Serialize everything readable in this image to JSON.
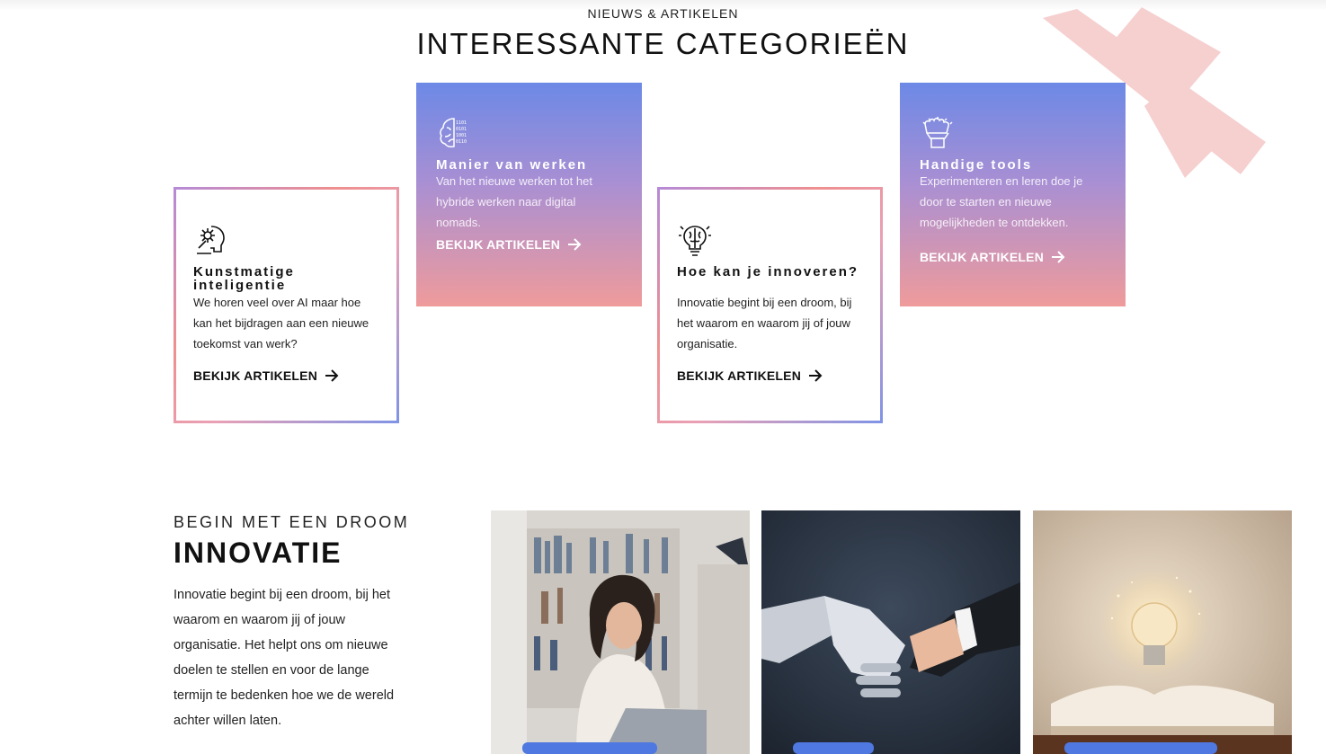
{
  "header": {
    "eyebrow": "NIEUWS & ARTIKELEN",
    "title": "INTERESSANTE CATEGORIEËN"
  },
  "categories": [
    {
      "style": "outline",
      "icon": "ai-head-icon",
      "title": "Kunstmatige inteligentie",
      "description": "We horen veel over AI maar hoe kan het bijdragen aan een nieuwe toekomst van werk?",
      "link_label": "BEKIJK ARTIKELEN"
    },
    {
      "style": "filled",
      "icon": "digital-brain-icon",
      "title": "Manier van werken",
      "description": "Van het nieuwe werken tot het hybride werken naar digital nomads.",
      "link_label": "BEKIJK ARTIKELEN"
    },
    {
      "style": "outline",
      "icon": "lightbulb-brain-icon",
      "title": "Hoe kan je innoveren?",
      "description": "Innovatie begint bij een droom, bij het waarom en waarom jij of jouw organisatie.",
      "link_label": "BEKIJK ARTIKELEN"
    },
    {
      "style": "filled",
      "icon": "robot-fist-icon",
      "title": "Handige tools",
      "description": "Experimenteren en leren doe je door te starten en nieuwe mogelijkheden te ontdekken.",
      "link_label": "BEKIJK ARTIKELEN"
    }
  ],
  "innovation": {
    "eyebrow": "BEGIN MET EEN DROOM",
    "title": "INNOVATIE",
    "body": "Innovatie begint bij een droom, bij het waarom en waarom jij of jouw organisatie. Het helpt ons om nieuwe doelen te stellen en voor de lange termijn te bedenken hoe we de wereld achter willen laten."
  },
  "colors": {
    "accent_blue": "#4f78e0",
    "gradient_top": "#6c89e6",
    "gradient_bottom": "#ef9b9b",
    "cross_pink": "#f6cfcf"
  }
}
